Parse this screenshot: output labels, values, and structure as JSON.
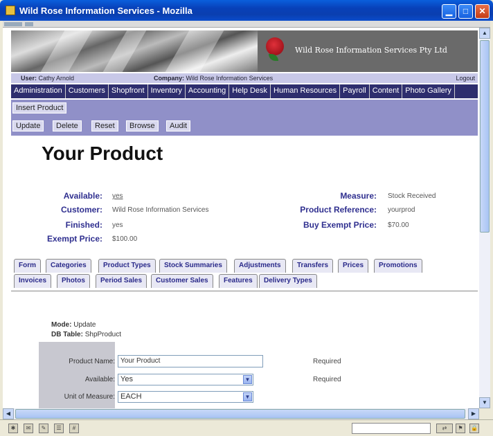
{
  "window": {
    "title": "Wild Rose Information Services - Mozilla"
  },
  "header": {
    "company_brand": "Wild Rose Information Services Pty Ltd",
    "user_label": "User:",
    "user_value": "Cathy Arnold",
    "company_label": "Company:",
    "company_value": "Wild Rose Information Services",
    "logout": "Logout"
  },
  "menu": [
    "Administration",
    "Customers",
    "Shopfront",
    "Inventory",
    "Accounting",
    "Help Desk",
    "Human Resources",
    "Payroll",
    "Content",
    "Photo Gallery"
  ],
  "actions": {
    "insert": "Insert Product",
    "update": "Update",
    "delete": "Delete",
    "reset": "Reset",
    "browse": "Browse",
    "audit": "Audit"
  },
  "product": {
    "title": "Your Product",
    "left_fields": [
      {
        "label": "Available:",
        "value": "yes"
      },
      {
        "label": "Customer:",
        "value": "Wild Rose Information Services"
      },
      {
        "label": "Finished:",
        "value": "yes"
      },
      {
        "label": "Exempt Price:",
        "value": "$100.00"
      }
    ],
    "right_fields": [
      {
        "label": "Measure:",
        "value": "Stock Received"
      },
      {
        "label": "Product Reference:",
        "value": "yourprod"
      },
      {
        "label": "Buy Exempt Price:",
        "value": "$70.00"
      }
    ]
  },
  "tabs": {
    "row1": [
      "Form",
      "Categories",
      "Product Types",
      "Stock Summaries",
      "Adjustments",
      "Transfers",
      "Prices",
      "Promotions"
    ],
    "row2": [
      "Invoices",
      "Photos",
      "Period Sales",
      "Customer Sales",
      "Features",
      "Delivery Types"
    ]
  },
  "form": {
    "mode_label": "Mode:",
    "mode_value": "Update",
    "table_label": "DB Table:",
    "table_value": "ShpProduct",
    "product_name_label": "Product Name:",
    "product_name_value": "Your Product",
    "available_label": "Available:",
    "available_value": "Yes",
    "uom_label": "Unit of Measure:",
    "uom_value": "EACH",
    "required": "Required"
  }
}
